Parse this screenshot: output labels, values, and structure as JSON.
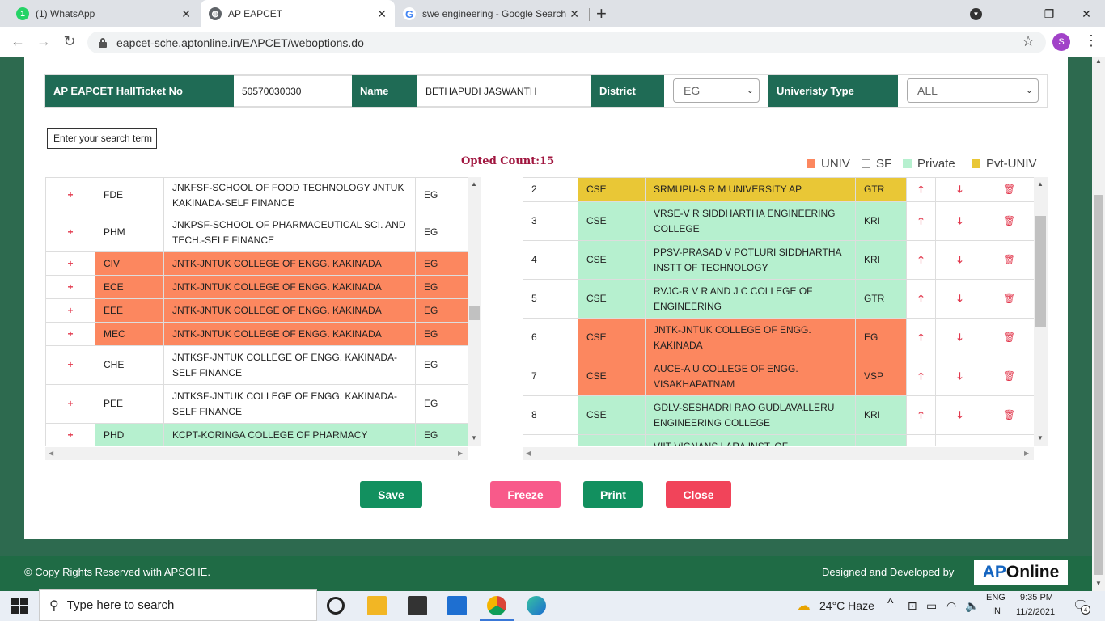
{
  "browser": {
    "tabs": [
      {
        "title": "(1) WhatsApp",
        "badge": "1"
      },
      {
        "title": "AP EAPCET"
      },
      {
        "title": "swe engineering - Google Search"
      }
    ],
    "url": "eapcet-sche.aptonline.in/EAPCET/weboptions.do",
    "profile_initial": "S"
  },
  "header": {
    "hallticket_label": "AP EAPCET HallTicket No",
    "hallticket_value": "50570030030",
    "name_label": "Name",
    "name_value": "BETHAPUDI JASWANTH",
    "district_label": "District",
    "district_value": "EG",
    "univ_type_label": "Univeristy Type",
    "univ_type_value": "ALL"
  },
  "search": {
    "placeholder": "Enter your search term"
  },
  "opted_count": "Opted Count:15",
  "legend": [
    {
      "label": "UNIV",
      "color": "#fc875f"
    },
    {
      "label": "SF",
      "color": "#ffffff"
    },
    {
      "label": "Private",
      "color": "#b6f0cf"
    },
    {
      "label": "Pvt-UNIV",
      "color": "#e9c736"
    }
  ],
  "left_rows": [
    {
      "branch": "FDE",
      "college": "JNKFSF-SCHOOL OF FOOD TECHNOLOGY JNTUK KAKINADA-SELF FINANCE",
      "dist": "EG",
      "type": "sf"
    },
    {
      "branch": "PHM",
      "college": "JNKPSF-SCHOOL OF PHARMACEUTICAL SCI. AND TECH.-SELF FINANCE",
      "dist": "EG",
      "type": "sf"
    },
    {
      "branch": "CIV",
      "college": "JNTK-JNTUK COLLEGE OF ENGG. KAKINADA",
      "dist": "EG",
      "type": "univ"
    },
    {
      "branch": "ECE",
      "college": "JNTK-JNTUK COLLEGE OF ENGG. KAKINADA",
      "dist": "EG",
      "type": "univ"
    },
    {
      "branch": "EEE",
      "college": "JNTK-JNTUK COLLEGE OF ENGG. KAKINADA",
      "dist": "EG",
      "type": "univ"
    },
    {
      "branch": "MEC",
      "college": "JNTK-JNTUK COLLEGE OF ENGG. KAKINADA",
      "dist": "EG",
      "type": "univ"
    },
    {
      "branch": "CHE",
      "college": "JNTKSF-JNTUK COLLEGE OF ENGG. KAKINADA-SELF FINANCE",
      "dist": "EG",
      "type": "sf"
    },
    {
      "branch": "PEE",
      "college": "JNTKSF-JNTUK COLLEGE OF ENGG. KAKINADA-SELF FINANCE",
      "dist": "EG",
      "type": "sf"
    },
    {
      "branch": "PHD",
      "college": "KCPT-KORINGA COLLEGE OF PHARMACY",
      "dist": "EG",
      "type": "priv"
    }
  ],
  "right_rows": [
    {
      "no": "2",
      "branch": "CSE",
      "college": "SRMUPU-S R M UNIVERSITY AP",
      "dist": "GTR",
      "type": "pvt"
    },
    {
      "no": "3",
      "branch": "CSE",
      "college": "VRSE-V R SIDDHARTHA ENGINEERING COLLEGE",
      "dist": "KRI",
      "type": "priv"
    },
    {
      "no": "4",
      "branch": "CSE",
      "college": "PPSV-PRASAD V POTLURI SIDDHARTHA INSTT OF TECHNOLOGY",
      "dist": "KRI",
      "type": "priv"
    },
    {
      "no": "5",
      "branch": "CSE",
      "college": "RVJC-R V R AND J C COLLEGE OF ENGINEERING",
      "dist": "GTR",
      "type": "priv"
    },
    {
      "no": "6",
      "branch": "CSE",
      "college": "JNTK-JNTUK COLLEGE OF ENGG. KAKINADA",
      "dist": "EG",
      "type": "univ"
    },
    {
      "no": "7",
      "branch": "CSE",
      "college": "AUCE-A U COLLEGE OF ENGG. VISAKHAPATNAM",
      "dist": "VSP",
      "type": "univ"
    },
    {
      "no": "8",
      "branch": "CSE",
      "college": "GDLV-SESHADRI RAO GUDLAVALLERU ENGINEERING COLLEGE",
      "dist": "KRI",
      "type": "priv"
    },
    {
      "no": "",
      "branch": "",
      "college": "VIIT-VIGNANS LARA INST. OF",
      "dist": "",
      "type": "priv"
    }
  ],
  "buttons": {
    "save": "Save",
    "freeze": "Freeze",
    "print": "Print",
    "close": "Close"
  },
  "footer": {
    "copyright": "© Copy Rights Reserved with APSCHE.",
    "designed_by": "Designed and Developed by",
    "logo_ap": "AP",
    "logo_online": "Online"
  },
  "taskbar": {
    "search_placeholder": "Type here to search",
    "weather": "24°C  Haze",
    "lang1": "ENG",
    "lang2": "IN",
    "time": "9:35 PM",
    "date": "11/2/2021",
    "notif_count": "4"
  }
}
